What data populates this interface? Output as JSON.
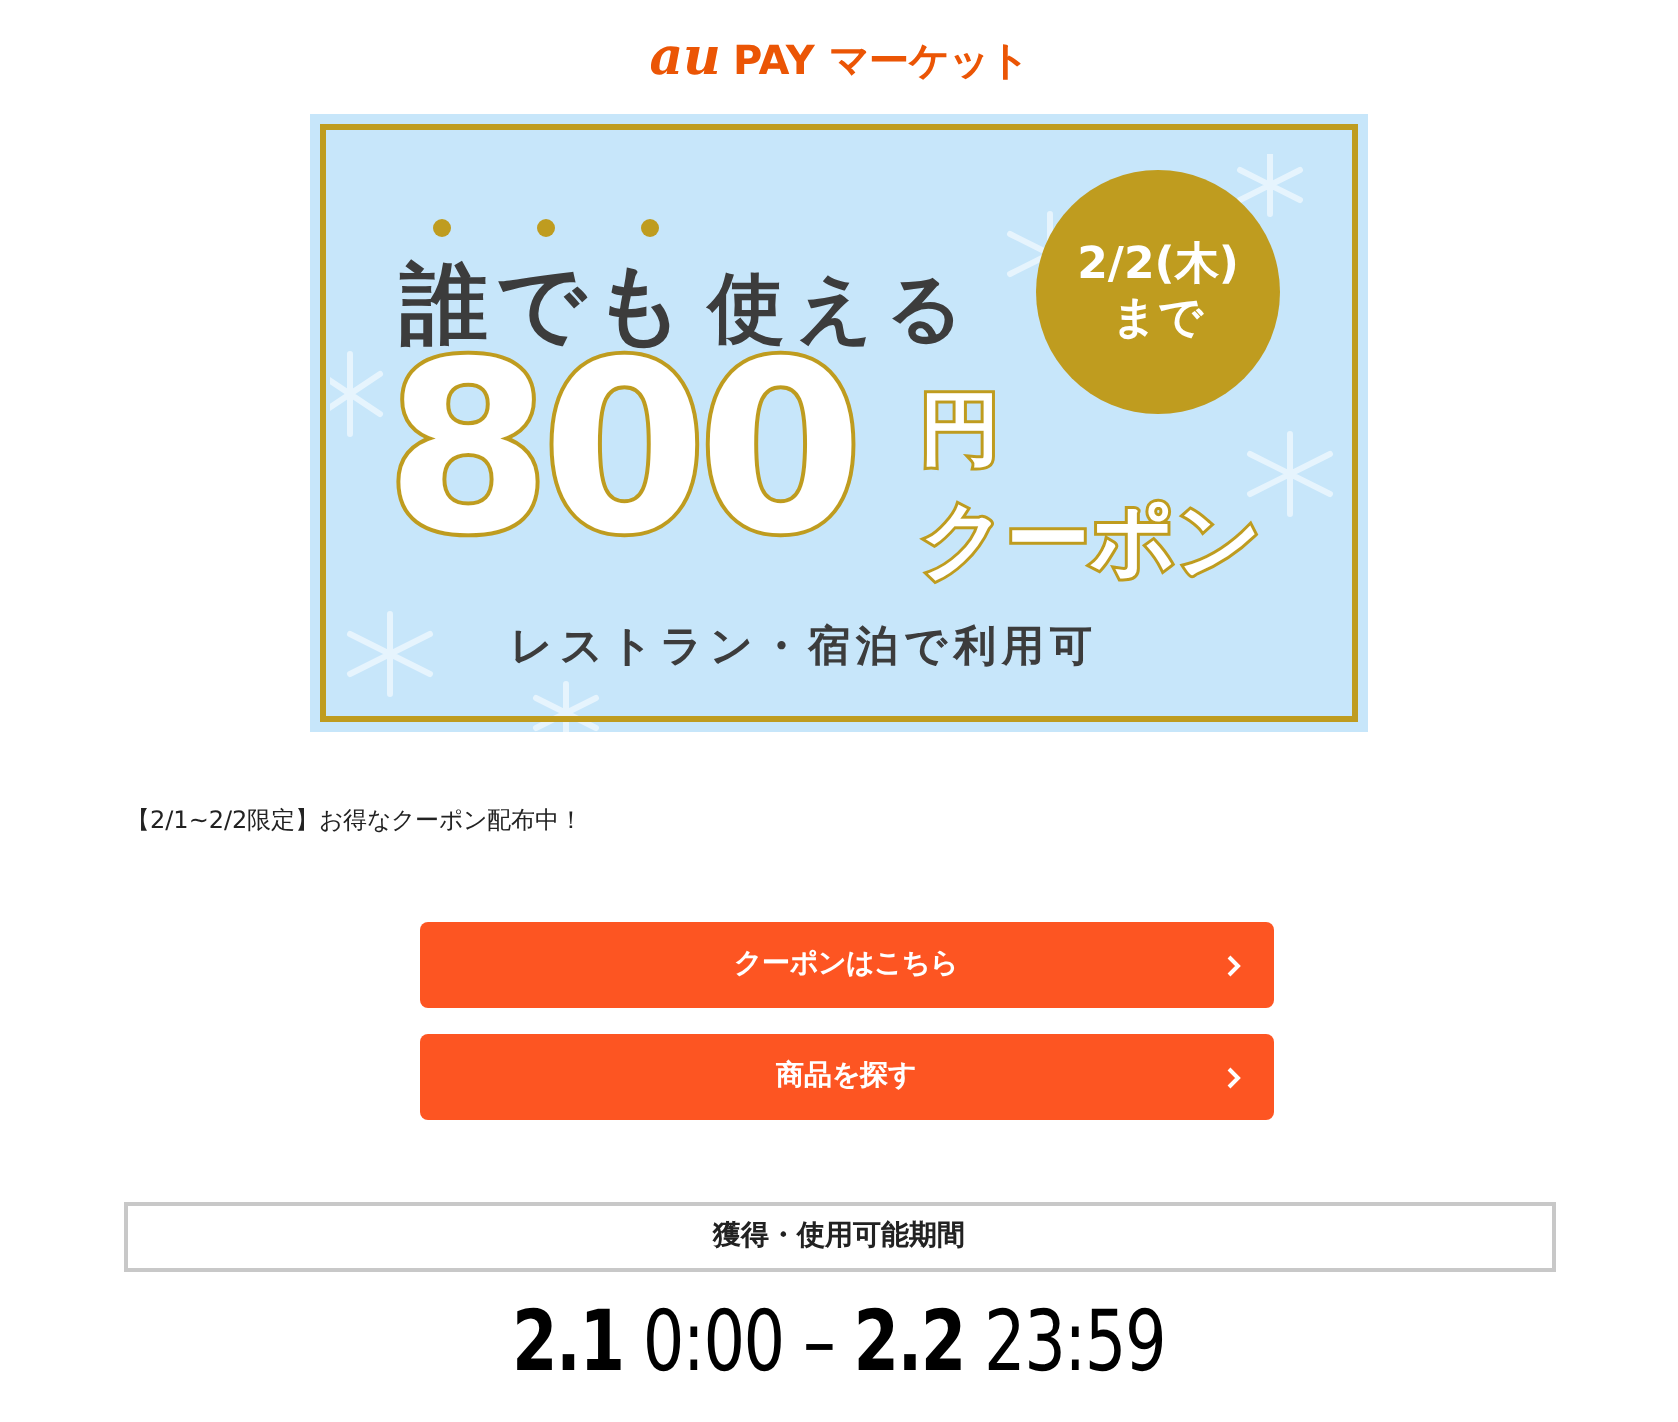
{
  "logo": {
    "mark": "au",
    "text": "PAY マーケット"
  },
  "banner": {
    "headline_emphasis": "誰でも",
    "headline_rest": "使える",
    "deadline_date": "2/2(木)",
    "deadline_suffix": "まで",
    "amount": "800",
    "unit": "円",
    "coupon": "クーポン",
    "usage": "レストラン・宿泊で利用可"
  },
  "notice": "【2/1~2/2限定】お得なクーポン配布中！",
  "buttons": [
    {
      "label": "クーポンはこちら"
    },
    {
      "label": "商品を探す"
    }
  ],
  "period": {
    "heading": "獲得・使用可能期間",
    "value": "**2.1** 0:00 – **2.2** 23:59"
  }
}
